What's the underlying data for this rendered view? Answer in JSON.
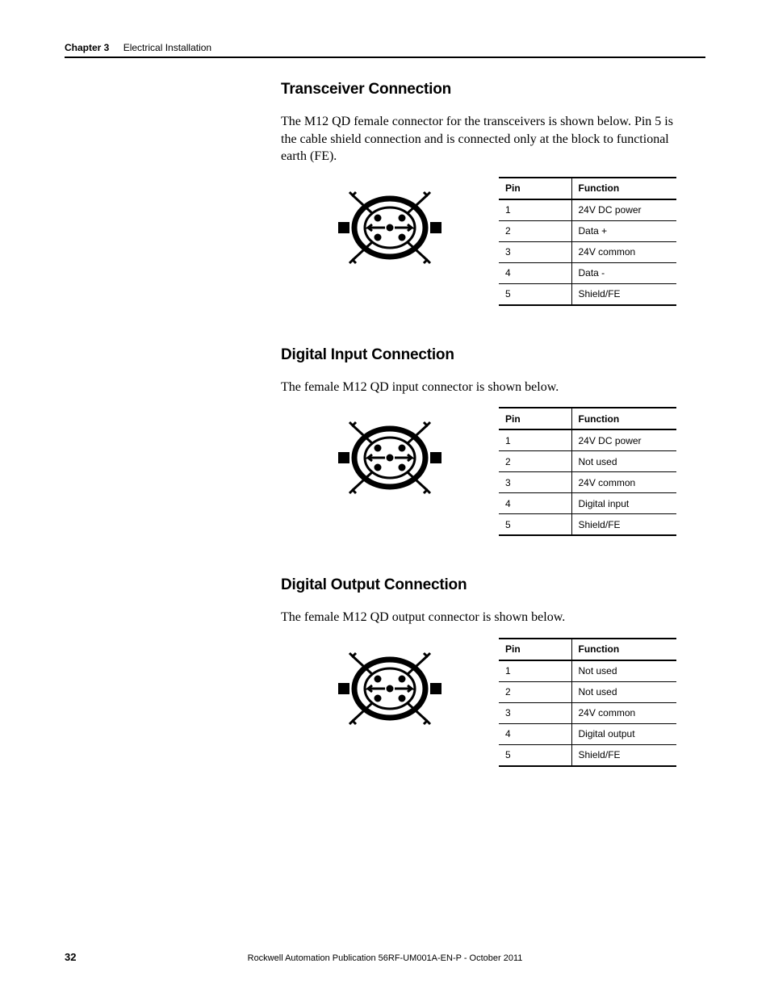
{
  "header": {
    "chapter_label": "Chapter 3",
    "chapter_title": "Electrical Installation"
  },
  "sections": {
    "transceiver": {
      "heading": "Transceiver Connection",
      "intro": "The M12 QD female connector for the transceivers is shown below. Pin 5 is the cable shield connection and is connected only at the block to functional earth (FE).",
      "table": {
        "col_pin": "Pin",
        "col_func": "Function",
        "rows": [
          {
            "pin": "1",
            "func": "24V DC power"
          },
          {
            "pin": "2",
            "func": "Data +"
          },
          {
            "pin": "3",
            "func": "24V common"
          },
          {
            "pin": "4",
            "func": "Data -"
          },
          {
            "pin": "5",
            "func": "Shield/FE"
          }
        ]
      }
    },
    "digital_input": {
      "heading": "Digital Input Connection",
      "intro": "The female M12 QD input connector is shown below.",
      "table": {
        "col_pin": "Pin",
        "col_func": "Function",
        "rows": [
          {
            "pin": "1",
            "func": "24V DC power"
          },
          {
            "pin": "2",
            "func": "Not used"
          },
          {
            "pin": "3",
            "func": "24V common"
          },
          {
            "pin": "4",
            "func": "Digital input"
          },
          {
            "pin": "5",
            "func": "Shield/FE"
          }
        ]
      }
    },
    "digital_output": {
      "heading": "Digital Output Connection",
      "intro": "The female M12 QD output connector is shown below.",
      "table": {
        "col_pin": "Pin",
        "col_func": "Function",
        "rows": [
          {
            "pin": "1",
            "func": "Not used"
          },
          {
            "pin": "2",
            "func": "Not used"
          },
          {
            "pin": "3",
            "func": "24V common"
          },
          {
            "pin": "4",
            "func": "Digital output"
          },
          {
            "pin": "5",
            "func": "Shield/FE"
          }
        ]
      }
    }
  },
  "footer": {
    "page_number": "32",
    "publication": "Rockwell Automation Publication 56RF-UM001A-EN-P - October 2011"
  }
}
